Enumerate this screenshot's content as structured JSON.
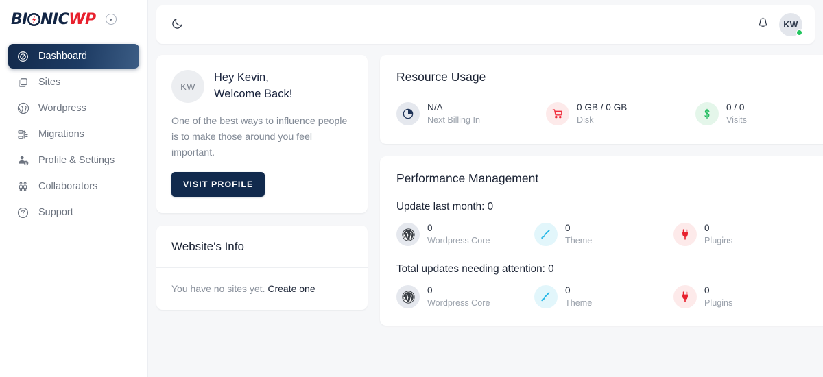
{
  "brand": {
    "name_part1": "BI",
    "name_o": "O",
    "name_part2": "NIC",
    "name_accent": "WP",
    "accent_color": "#e8212e",
    "navy_color": "#122544"
  },
  "sidebar": {
    "items": [
      {
        "label": "Dashboard",
        "icon": "speedometer-icon",
        "active": true
      },
      {
        "label": "Sites",
        "icon": "copy-icon",
        "active": false
      },
      {
        "label": "Wordpress",
        "icon": "wordpress-icon",
        "active": false
      },
      {
        "label": "Migrations",
        "icon": "migration-icon",
        "active": false
      },
      {
        "label": "Profile & Settings",
        "icon": "user-settings-icon",
        "active": false
      },
      {
        "label": "Collaborators",
        "icon": "collaborators-icon",
        "active": false
      },
      {
        "label": "Support",
        "icon": "question-circle-icon",
        "active": false
      }
    ]
  },
  "topbar": {
    "theme_toggle_icon": "moon-icon",
    "notifications_icon": "bell-icon",
    "avatar_initials": "KW",
    "status_color": "#22c55e"
  },
  "welcome": {
    "avatar_initials": "KW",
    "greeting_line1": "Hey Kevin,",
    "greeting_line2": "Welcome Back!",
    "quote": "One of the best ways to influence people is to make those around you feel important.",
    "button_label": "VISIT PROFILE"
  },
  "website_info": {
    "title": "Website's Info",
    "empty_text": "You have no sites yet.",
    "link_label": "Create one"
  },
  "resource_usage": {
    "title": "Resource Usage",
    "metrics": [
      {
        "value": "N/A",
        "label": "Next Billing In",
        "icon": "pie-chart-icon",
        "bg": "bg-slate"
      },
      {
        "value": "0 GB / 0 GB",
        "label": "Disk",
        "icon": "cart-icon",
        "bg": "bg-pink"
      },
      {
        "value": "0 / 0",
        "label": "Visits",
        "icon": "dollar-icon",
        "bg": "bg-green"
      }
    ]
  },
  "performance": {
    "title": "Performance Management",
    "sections": [
      {
        "heading": "Update last month: 0",
        "metrics": [
          {
            "value": "0",
            "label": "Wordpress Core",
            "icon": "wordpress-icon",
            "bg": "bg-slate"
          },
          {
            "value": "0",
            "label": "Theme",
            "icon": "brush-icon",
            "bg": "bg-cyan"
          },
          {
            "value": "0",
            "label": "Plugins",
            "icon": "plug-icon",
            "bg": "bg-pink"
          }
        ]
      },
      {
        "heading": "Total updates needing attention: 0",
        "metrics": [
          {
            "value": "0",
            "label": "Wordpress Core",
            "icon": "wordpress-icon",
            "bg": "bg-slate"
          },
          {
            "value": "0",
            "label": "Theme",
            "icon": "brush-icon",
            "bg": "bg-cyan"
          },
          {
            "value": "0",
            "label": "Plugins",
            "icon": "plug-icon",
            "bg": "bg-pink"
          }
        ]
      }
    ]
  }
}
